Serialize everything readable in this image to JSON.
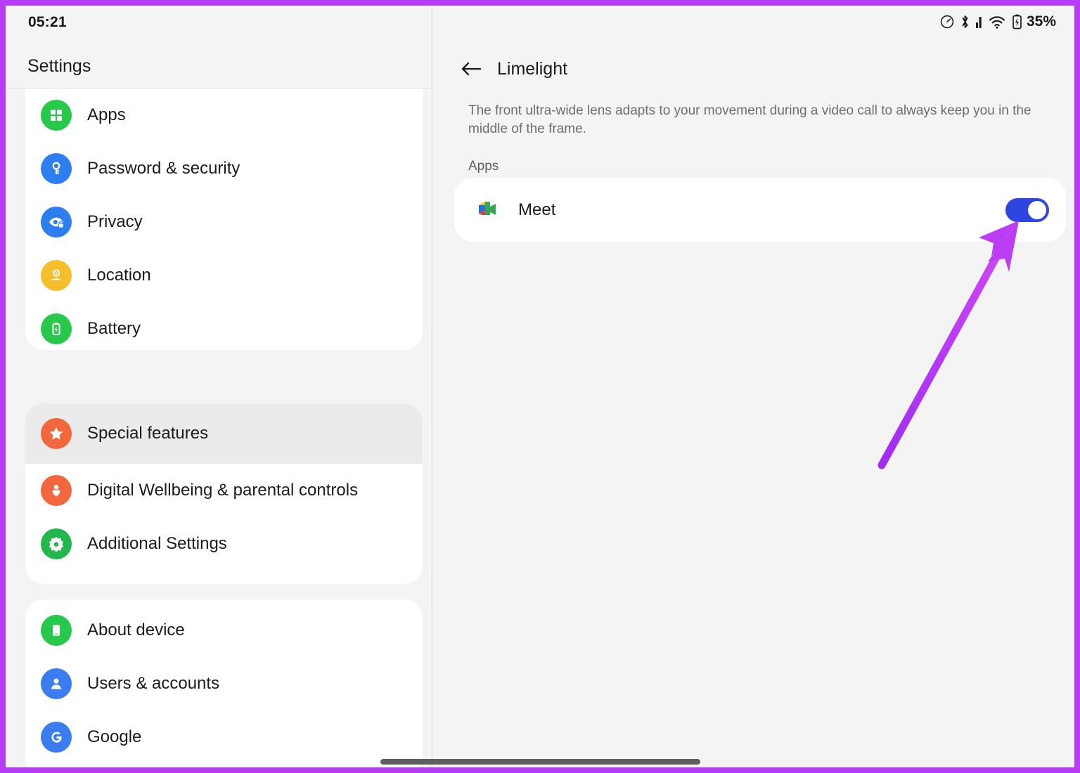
{
  "statusbar": {
    "clock": "05:21",
    "battery_percent": "35%",
    "icons": [
      "data-saver-icon",
      "bluetooth-icon",
      "signal-bars-icon",
      "wifi-icon",
      "battery-charging-icon"
    ]
  },
  "sidebar": {
    "title": "Settings",
    "groups": [
      {
        "items": [
          {
            "label": "Apps",
            "icon": "apps-grid-icon",
            "color": "#27c94a",
            "selected": false
          },
          {
            "label": "Password & security",
            "icon": "key-icon",
            "color": "#2d7ff0",
            "selected": false
          },
          {
            "label": "Privacy",
            "icon": "eye-lock-icon",
            "color": "#2d7ff0",
            "selected": false
          },
          {
            "label": "Location",
            "icon": "location-pin-icon",
            "color": "#f7be2c",
            "selected": false
          },
          {
            "label": "Battery",
            "icon": "battery-icon",
            "color": "#27c94a",
            "selected": false
          }
        ]
      },
      {
        "items": [
          {
            "label": "Special features",
            "icon": "star-icon",
            "color": "#f2683c",
            "selected": true
          },
          {
            "label": "Digital Wellbeing & parental controls",
            "icon": "person-heart-icon",
            "color": "#f2683c",
            "selected": false
          },
          {
            "label": "Additional Settings",
            "icon": "gear-icon",
            "color": "#22b84e",
            "selected": false
          }
        ]
      },
      {
        "items": [
          {
            "label": "About device",
            "icon": "phone-icon",
            "color": "#27c94a",
            "selected": false
          },
          {
            "label": "Users & accounts",
            "icon": "person-icon",
            "color": "#3b7df0",
            "selected": false
          },
          {
            "label": "Google",
            "icon": "google-g-icon",
            "color": "#3b7df0",
            "selected": false
          }
        ]
      }
    ]
  },
  "detail": {
    "back_icon": "back-arrow-icon",
    "title": "Limelight",
    "description": "The front ultra-wide lens adapts to your movement during a video call to always keep you in the middle of the frame.",
    "section_label": "Apps",
    "apps": [
      {
        "name": "Meet",
        "icon": "google-meet-icon",
        "toggle_on": true
      }
    ]
  },
  "annotation": {
    "type": "arrow",
    "color_start": "#a22cf2",
    "color_end": "#cf47f7",
    "points_to": "meet-toggle"
  },
  "colors": {
    "frame": "#b63cf5",
    "background": "#f4f4f4",
    "card": "#ffffff",
    "toggle_on": "#2f45e0",
    "selected_row": "#ebebeb"
  },
  "navigation": {
    "home_bar": "gesture-home-bar"
  }
}
